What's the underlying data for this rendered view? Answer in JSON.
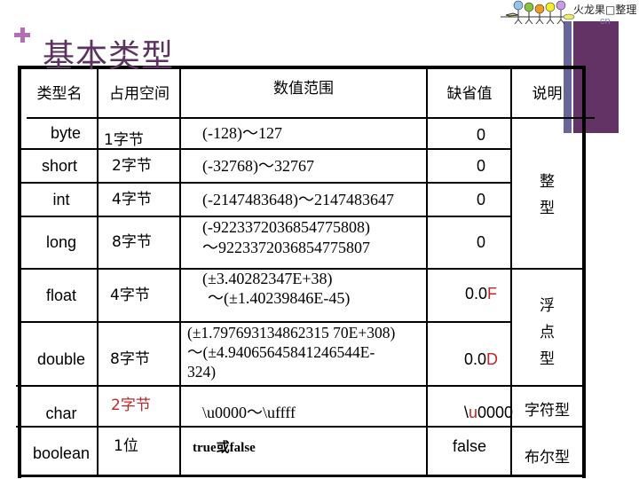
{
  "slide": {
    "title": "基本类型",
    "logo": {
      "text": "火龙果□整理",
      "subtext": "cn"
    }
  },
  "table": {
    "headers": [
      "类型名",
      "占用空间",
      "数值范围",
      "缺省值",
      "说明"
    ],
    "rows": [
      {
        "type": "byte",
        "size": "1字节",
        "range": [
          "(-128)～127"
        ],
        "default": "0"
      },
      {
        "type": "short",
        "size": "2字节",
        "range": [
          "(-32768)～32767"
        ],
        "default": "0"
      },
      {
        "type": "int",
        "size": "4字节",
        "range": [
          "(-2147483648)～2147483647"
        ],
        "default": "0"
      },
      {
        "type": "long",
        "size": "8字节",
        "range": [
          "(-9223372036854775808)",
          "～9223372036854775807"
        ],
        "default": "0"
      },
      {
        "type": "float",
        "size": "4字节",
        "range": [
          "(±3.40282347E+38)",
          "～(±1.40239846E-45)"
        ],
        "default_prefix": "0.0",
        "default_suffix": "F"
      },
      {
        "type": "double",
        "size": "8字节",
        "range": [
          "(±1.797693134862315 70E+308)",
          "～(±4.94065645841246544E-",
          "324)"
        ],
        "default_prefix": "0.0",
        "default_suffix": "D"
      },
      {
        "type": "char",
        "size": "2字节",
        "range": [
          "\\u0000～\\uffff"
        ],
        "default_prefix": "\\",
        "default_red": "u",
        "default_suffix": "0000"
      },
      {
        "type": "boolean",
        "size": "1位",
        "range": [
          "true或false"
        ],
        "default": "false"
      }
    ],
    "categories": {
      "integer": [
        "整",
        "型"
      ],
      "float": [
        "浮",
        "点",
        "型"
      ],
      "char": "字符型",
      "boolean": "布尔型"
    }
  },
  "colors": {
    "title": "#5c3360",
    "accent_plus": "#b36fb5",
    "bar_blue": "#6a6598",
    "bar_purple": "#643366",
    "highlight_red": "#c0262a"
  }
}
